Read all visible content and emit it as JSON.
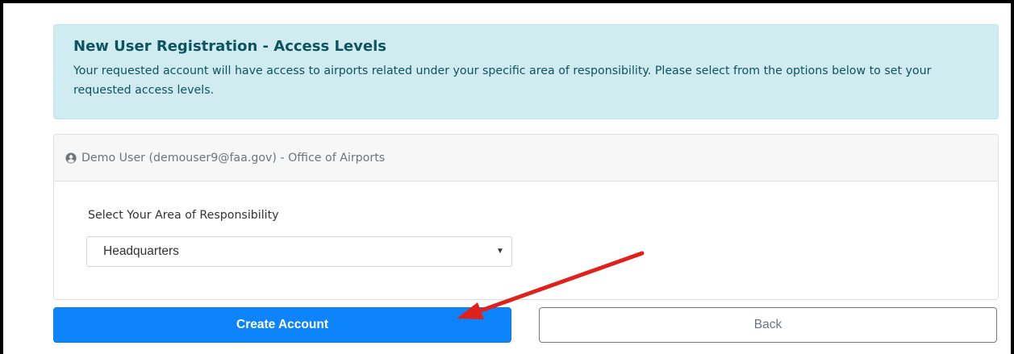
{
  "alert": {
    "title": "New User Registration - Access Levels",
    "text": "Your requested account will have access to airports related under your specific area of responsibility. Please select from the options below to set your requested access levels."
  },
  "card": {
    "user_line": "Demo User (demouser9@faa.gov) - Office of Airports",
    "icon": "user-circle-icon",
    "field_label": "Select Your Area of Responsibility",
    "selected_value": "Headquarters"
  },
  "buttons": {
    "create_label": "Create Account",
    "back_label": "Back"
  },
  "colors": {
    "alert_bg": "#d1ecf1",
    "alert_text": "#0c5460",
    "primary": "#0d84fb",
    "annotation_arrow": "#e0201b"
  }
}
